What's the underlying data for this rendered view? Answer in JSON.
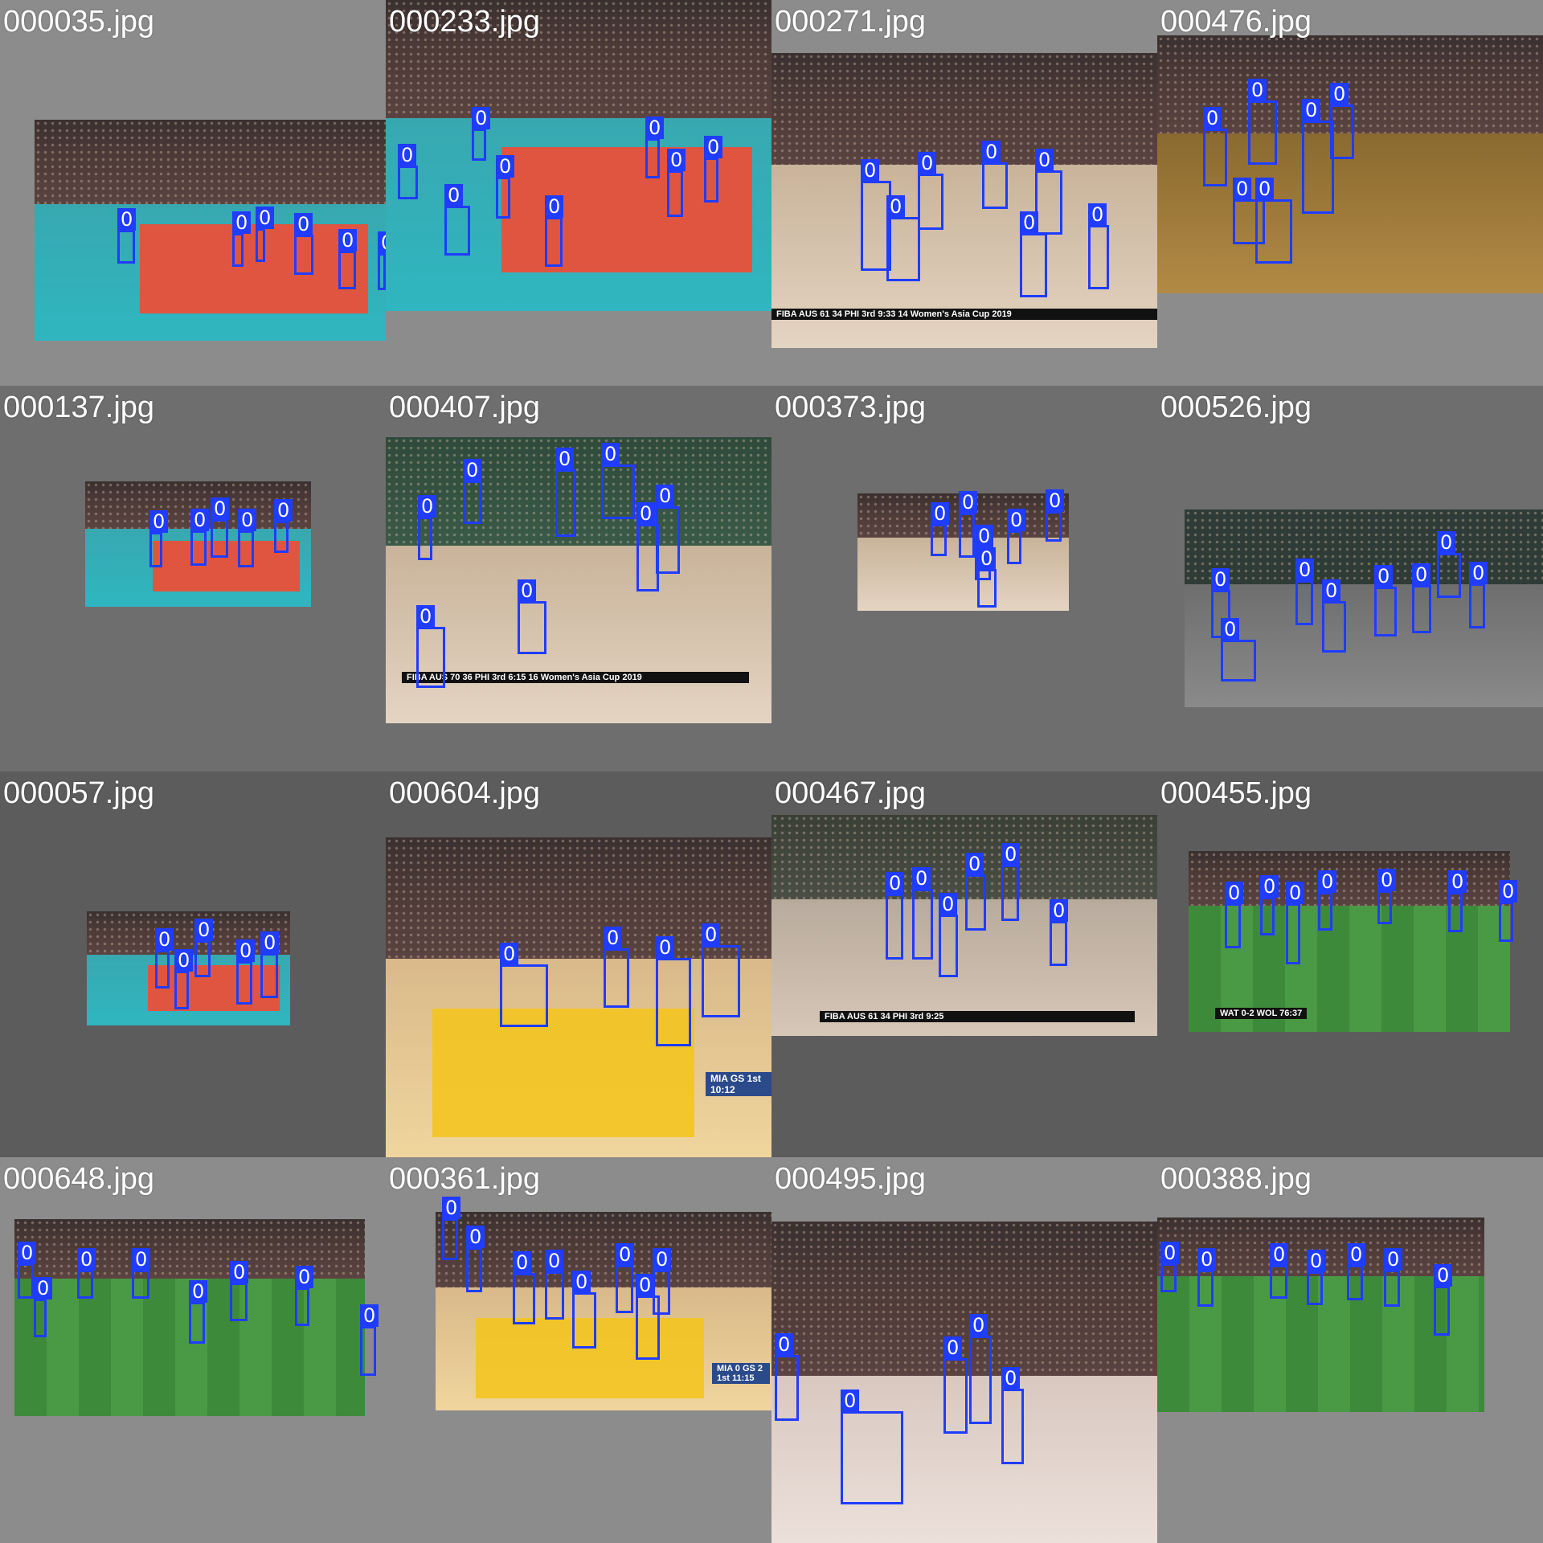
{
  "detection_label": "0",
  "tiles": [
    {
      "file": "000035.jpg",
      "score": ""
    },
    {
      "file": "000233.jpg",
      "score": ""
    },
    {
      "file": "000271.jpg",
      "score": "FIBA  AUS  61  34  PHI  3rd  9:33  14  Women's Asia Cup 2019"
    },
    {
      "file": "000476.jpg",
      "score": ""
    },
    {
      "file": "000137.jpg",
      "score": ""
    },
    {
      "file": "000407.jpg",
      "score": "FIBA  AUS  70  36  PHI  3rd  6:15  16  Women's Asia Cup 2019"
    },
    {
      "file": "000373.jpg",
      "score": ""
    },
    {
      "file": "000526.jpg",
      "score": ""
    },
    {
      "file": "000057.jpg",
      "score": ""
    },
    {
      "file": "000604.jpg",
      "score": "MIA  GS  1st  10:12"
    },
    {
      "file": "000467.jpg",
      "score": "FIBA  AUS  61  34  PHI  3rd  9:25"
    },
    {
      "file": "000455.jpg",
      "score": "WAT 0-2 WOL 76:37"
    },
    {
      "file": "000648.jpg",
      "score": ""
    },
    {
      "file": "000361.jpg",
      "score": "MIA 0  GS 2  1st 11:15"
    },
    {
      "file": "000495.jpg",
      "score": ""
    },
    {
      "file": "000388.jpg",
      "score": ""
    }
  ]
}
